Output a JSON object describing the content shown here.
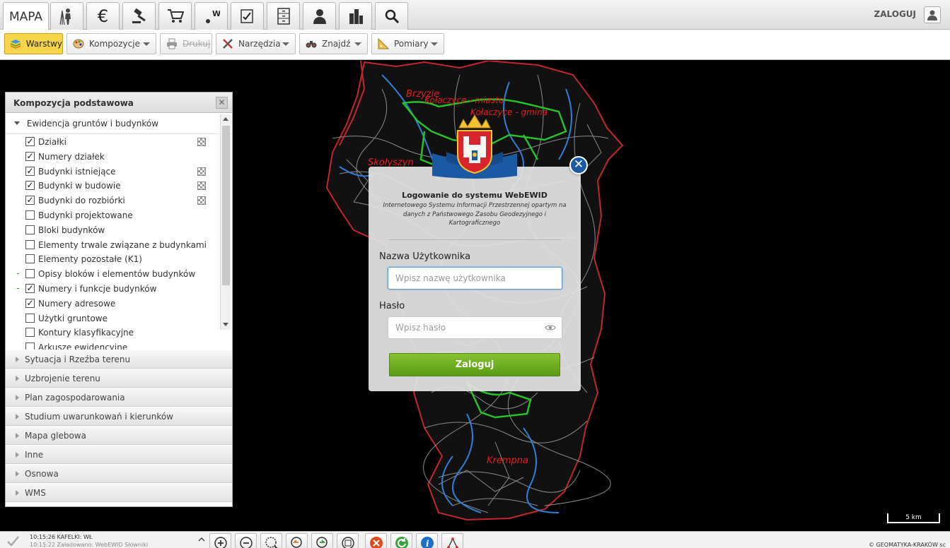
{
  "app": {
    "active_tab": "MAPA",
    "tabs": [
      "surveyor-icon",
      "euro-icon",
      "gavel-icon",
      "cart-icon",
      "weight-icon",
      "checklist-icon",
      "cabinet-icon",
      "user-icon",
      "buildings-icon",
      "search-icon"
    ],
    "login_link": "ZALOGUJ"
  },
  "toolbar": {
    "warstwy": "Warstwy",
    "kompozycje": "Kompozycje",
    "drukuj": "Drukuj",
    "narzedzia": "Narzędzia",
    "znajdz": "Znajdź",
    "pomiary": "Pomiary"
  },
  "map": {
    "labels": [
      "Brzyzie",
      "Kołaczyce - miasto",
      "Kołaczyce - gmina",
      "Skołyszyn",
      "Krempna"
    ],
    "scale": "5 km",
    "colors": {
      "roads": "#9a9a9a",
      "rivers": "#2f7fd8",
      "boundary": "#e02424",
      "municipal": "#27c227"
    }
  },
  "panel": {
    "title": "Kompozycja podstawowa",
    "open_group": "Ewidencja gruntów i budynków",
    "layers": [
      {
        "label": "Działki",
        "checked": true,
        "legend": true
      },
      {
        "label": "Numery działek",
        "checked": true,
        "legend": false
      },
      {
        "label": "Budynki istniejące",
        "checked": true,
        "legend": true
      },
      {
        "label": "Budynki w budowie",
        "checked": true,
        "legend": true
      },
      {
        "label": "Budynki do rozbiórki",
        "checked": true,
        "legend": true
      },
      {
        "label": "Budynki projektowane",
        "checked": false,
        "legend": false
      },
      {
        "label": "Bloki budynków",
        "checked": false,
        "legend": false
      },
      {
        "label": "Elementy trwale związane z budynkami",
        "checked": false,
        "legend": false
      },
      {
        "label": "Elementy pozostałe (K1)",
        "checked": false,
        "legend": false
      },
      {
        "label": "Opisy bloków i elementów budynków",
        "checked": false,
        "legend": false,
        "dash": true
      },
      {
        "label": "Numery i funkcje budynków",
        "checked": true,
        "legend": false,
        "dash": true
      },
      {
        "label": "Numery adresowe",
        "checked": true,
        "legend": false
      },
      {
        "label": "Użytki gruntowe",
        "checked": false,
        "legend": false
      },
      {
        "label": "Kontury klasyfikacyjne",
        "checked": false,
        "legend": false
      },
      {
        "label": "Arkusze ewidencyjne",
        "checked": false,
        "legend": false
      }
    ],
    "closed_groups": [
      "Sytuacja i Rzeźba terenu",
      "Uzbrojenie terenu",
      "Plan zagospodarowania",
      "Studium uwarunkowań i kierunków",
      "Mapa glebowa",
      "Inne",
      "Osnowa",
      "WMS"
    ]
  },
  "login": {
    "title": "Logowanie do systemu WebEWID",
    "subtitle": "Internetowego Systemu Informacji Przestrzennej opartym na danych z Państwowego Zasobu Geodezyjnego i Kartograficznego",
    "username_label": "Nazwa Użytkownika",
    "username_placeholder": "Wpisz nazwę użytkownika",
    "password_label": "Hasło",
    "password_placeholder": "Wpisz hasło",
    "submit": "Zaloguj"
  },
  "status": {
    "line1": "10:15:26 KAFELKI: WŁ",
    "line2": "10:15:22 Załadowano: WebEWID Słowniki",
    "tools": [
      "zoom-in-icon",
      "zoom-out-icon",
      "zoom-window-icon",
      "zoom-prev-icon",
      "zoom-next-icon",
      "zoom-extent-icon",
      "cancel-icon",
      "refresh-icon",
      "info-icon",
      "measure-icon"
    ],
    "copyright": "© GEOMATYKA-KRAKÓW sc"
  }
}
